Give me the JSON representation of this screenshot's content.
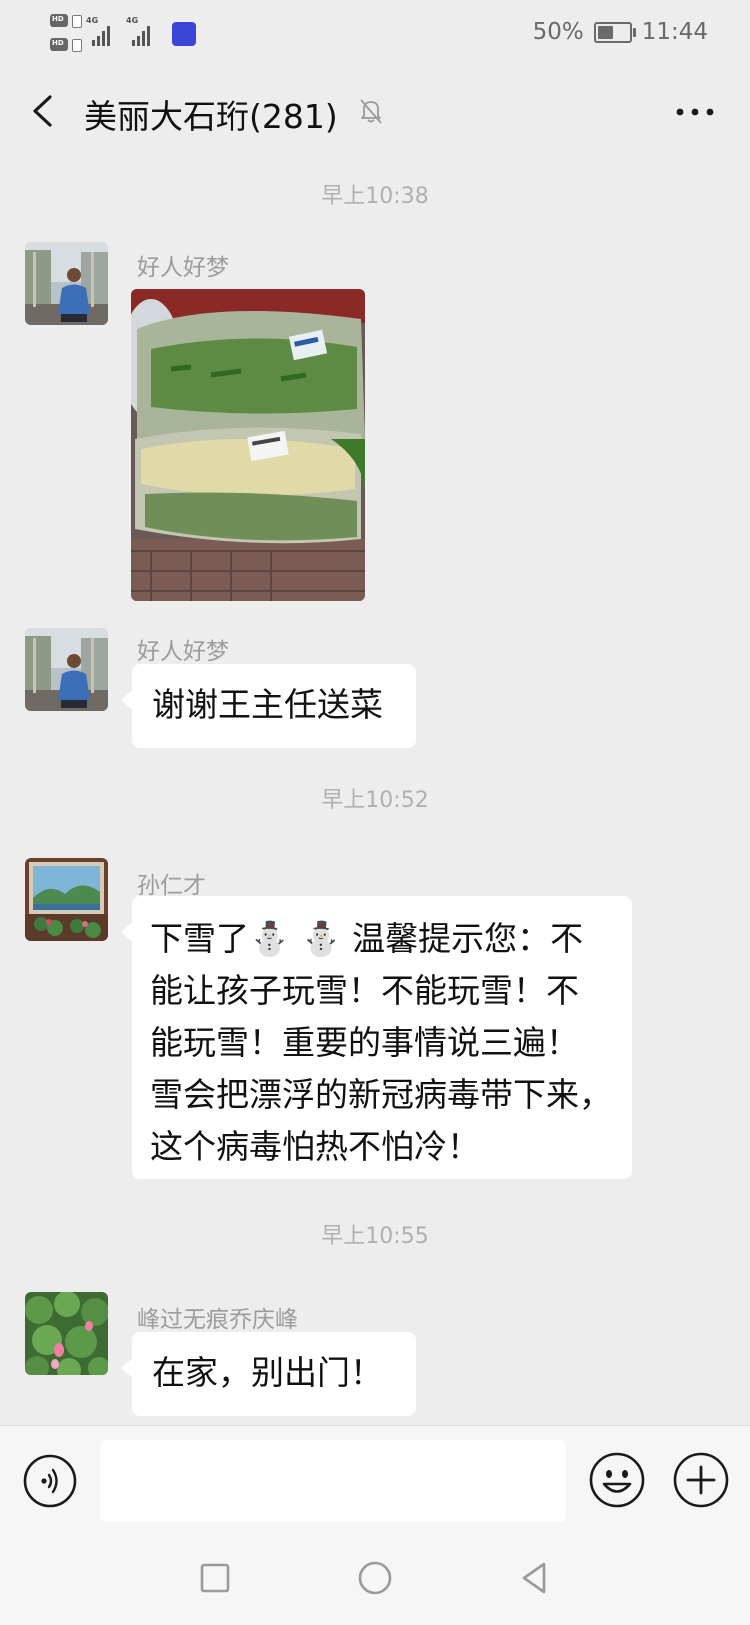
{
  "status_bar": {
    "hd1": "HD",
    "hd2": "HD",
    "net1": "4G",
    "net2": "4G",
    "battery_text": "50%",
    "battery_level": 0.5,
    "time": "11:44"
  },
  "header": {
    "title": "美丽大石珩(281)",
    "back_icon": "chevron-left-icon",
    "mute_icon": "bell-off-icon",
    "more_icon": "more-icon"
  },
  "messages": [
    {
      "type": "timestamp",
      "text": "早上10:38"
    },
    {
      "type": "image",
      "sender": "好人好梦",
      "avatar": "man-at-building-avatar",
      "image": "vegetables-in-plastic-bags"
    },
    {
      "type": "text",
      "sender": "好人好梦",
      "avatar": "man-at-building-avatar",
      "text": "谢谢王主任送菜"
    },
    {
      "type": "timestamp",
      "text": "早上10:52"
    },
    {
      "type": "text",
      "sender": "孙仁才",
      "avatar": "landscape-painting-avatar",
      "lines": [
        "下雪了⛄ ⛄ 温馨提示您：不",
        "能让孩子玩雪！不能玩雪！不",
        "能玩雪！重要的事情说三遍！",
        "雪会把漂浮的新冠病毒带下来，",
        "这个病毒怕热不怕冷！"
      ]
    },
    {
      "type": "timestamp",
      "text": "早上10:55"
    },
    {
      "type": "text",
      "sender": "峰过无痕乔庆峰",
      "avatar": "lotus-pond-avatar",
      "text": "在家，别出门！"
    }
  ],
  "input_bar": {
    "voice_icon": "voice-icon",
    "input_value": "",
    "emoji_icon": "emoji-icon",
    "plus_icon": "plus-icon"
  },
  "nav": {
    "recent_icon": "square-icon",
    "home_icon": "circle-icon",
    "back_icon": "triangle-back-icon"
  }
}
